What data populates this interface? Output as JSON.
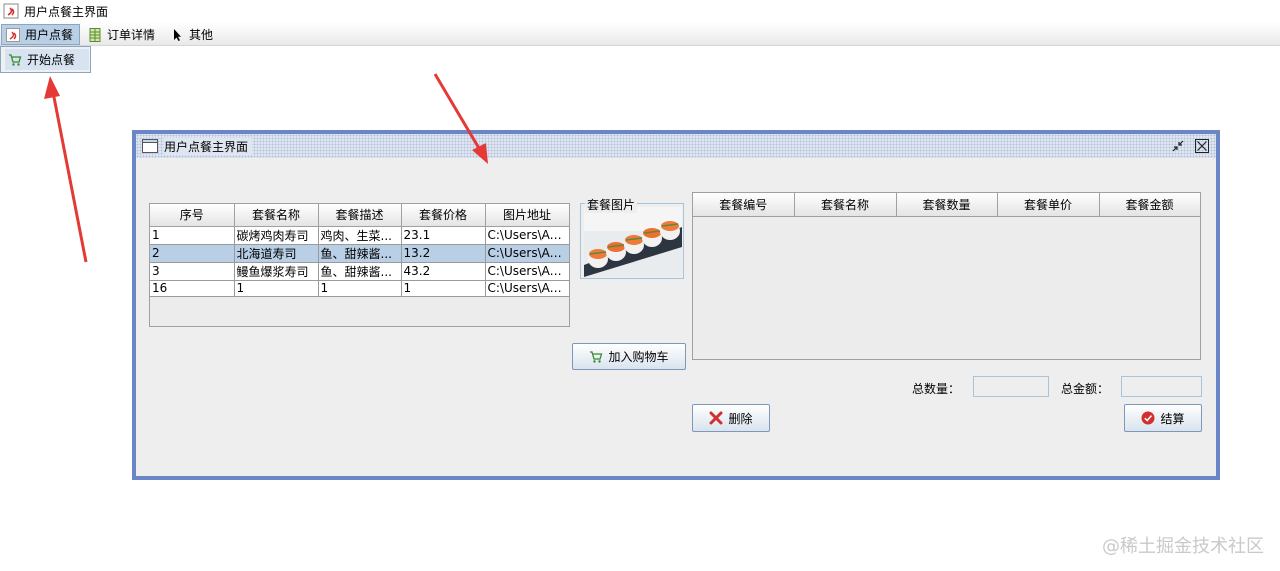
{
  "window": {
    "title": "用户点餐主界面"
  },
  "menubar": {
    "items": [
      {
        "label": "用户点餐",
        "icon": "app-logo-icon"
      },
      {
        "label": "订单详情",
        "icon": "spreadsheet-icon"
      },
      {
        "label": "其他",
        "icon": "cursor-icon"
      }
    ]
  },
  "dropdown": {
    "items": [
      {
        "label": "开始点餐",
        "icon": "cart-icon"
      }
    ]
  },
  "frame": {
    "title": "用户点餐主界面",
    "meal_table": {
      "columns": [
        "序号",
        "套餐名称",
        "套餐描述",
        "套餐价格",
        "图片地址"
      ],
      "rows": [
        [
          "1",
          "碳烤鸡肉寿司",
          "鸡肉、生菜...",
          "23.1",
          "C:\\Users\\Ad..."
        ],
        [
          "2",
          "北海道寿司",
          "鱼、甜辣酱...",
          "13.2",
          "C:\\Users\\Ad..."
        ],
        [
          "3",
          "鳗鱼爆浆寿司",
          "鱼、甜辣酱...",
          "43.2",
          "C:\\Users\\Ad..."
        ],
        [
          "16",
          "1",
          "1",
          "1",
          "C:\\Users\\Ad..."
        ]
      ],
      "selected_row": 1
    },
    "image_panel": {
      "legend": "套餐图片",
      "image": "sushi-photo"
    },
    "add_button": "加入购物车",
    "cart_table": {
      "columns": [
        "套餐编号",
        "套餐名称",
        "套餐数量",
        "套餐单价",
        "套餐金额"
      ]
    },
    "total_qty_label": "总数量：",
    "total_amount_label": "总金额：",
    "delete_button": "删除",
    "checkout_button": "结算"
  },
  "watermark": "@稀土掘金技术社区",
  "colors": {
    "selection": "#b8cfe5",
    "frame_border": "#6a86c6",
    "arrow": "#e53935"
  }
}
